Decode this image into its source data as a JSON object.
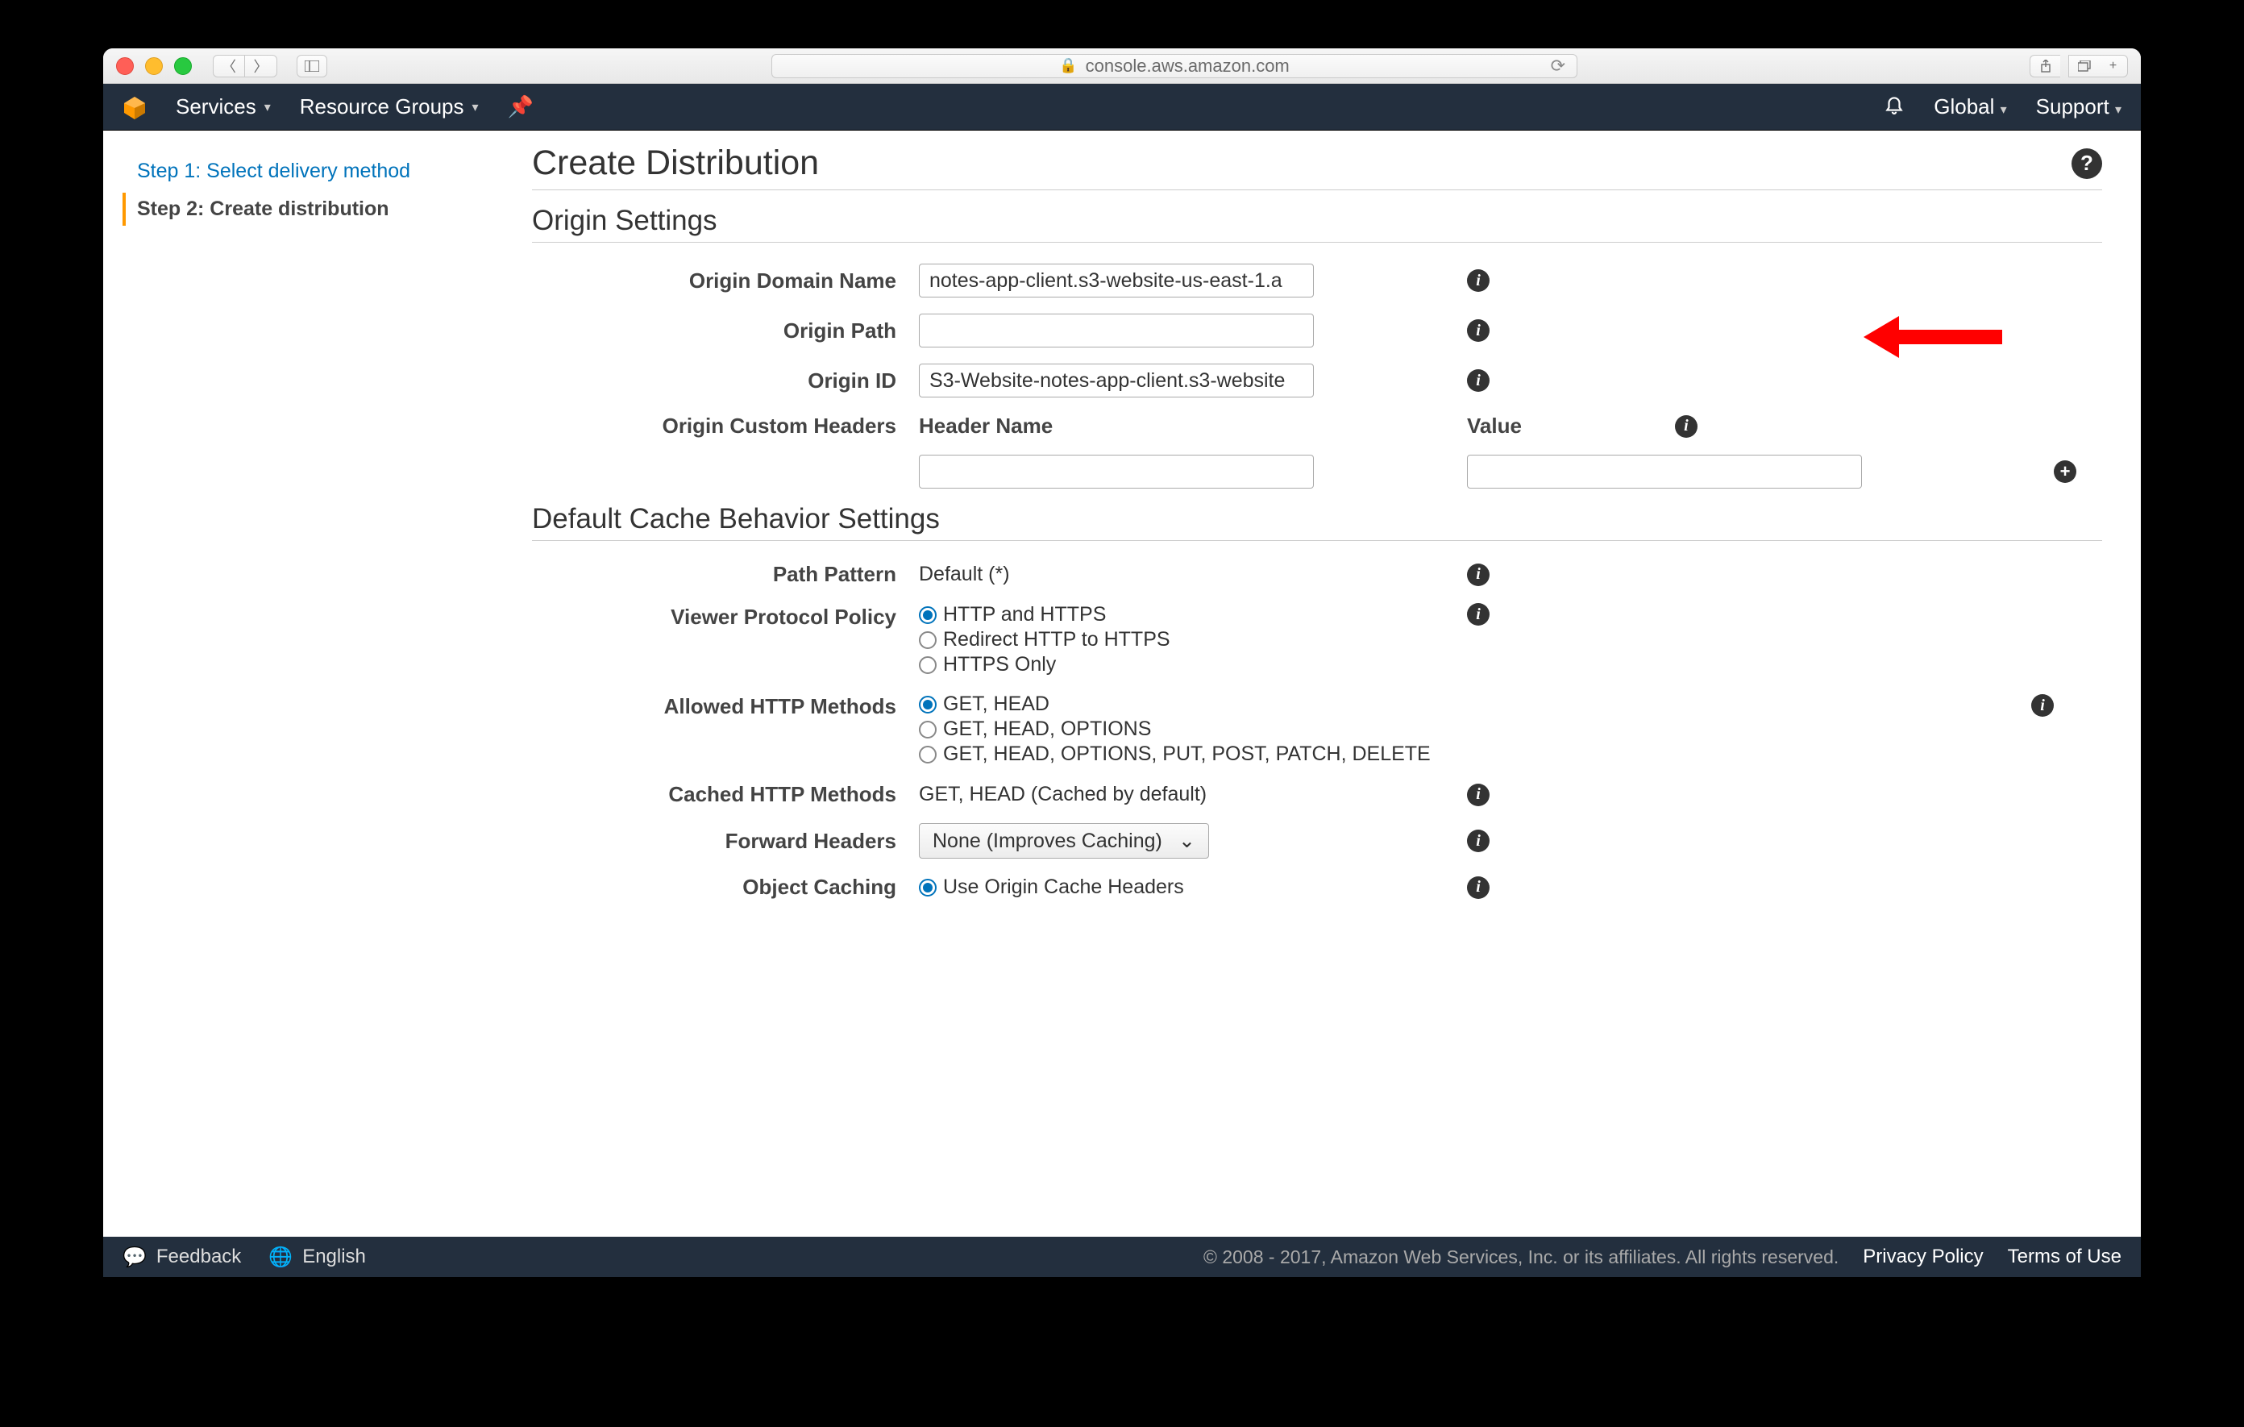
{
  "browser": {
    "url": "console.aws.amazon.com"
  },
  "awsbar": {
    "services": "Services",
    "resourceGroups": "Resource Groups",
    "global": "Global",
    "support": "Support"
  },
  "sidebar": {
    "step1": "Step 1: Select delivery method",
    "step2": "Step 2: Create distribution"
  },
  "page": {
    "title": "Create Distribution",
    "section_origin": "Origin Settings",
    "section_cache": "Default Cache Behavior Settings"
  },
  "origin": {
    "domainName": {
      "label": "Origin Domain Name",
      "value": "notes-app-client.s3-website-us-east-1.a"
    },
    "path": {
      "label": "Origin Path",
      "value": ""
    },
    "id": {
      "label": "Origin ID",
      "value": "S3-Website-notes-app-client.s3-website"
    },
    "customHeaders": {
      "label": "Origin Custom Headers",
      "headerName": "Header Name",
      "valueCol": "Value"
    }
  },
  "cache": {
    "pathPattern": {
      "label": "Path Pattern",
      "value": "Default (*)"
    },
    "viewerProtocol": {
      "label": "Viewer Protocol Policy",
      "options": [
        "HTTP and HTTPS",
        "Redirect HTTP to HTTPS",
        "HTTPS Only"
      ],
      "selected": 0
    },
    "allowedMethods": {
      "label": "Allowed HTTP Methods",
      "options": [
        "GET, HEAD",
        "GET, HEAD, OPTIONS",
        "GET, HEAD, OPTIONS, PUT, POST, PATCH, DELETE"
      ],
      "selected": 0
    },
    "cachedMethods": {
      "label": "Cached HTTP Methods",
      "value": "GET, HEAD (Cached by default)"
    },
    "forwardHeaders": {
      "label": "Forward Headers",
      "value": "None (Improves Caching)"
    },
    "objectCaching": {
      "label": "Object Caching",
      "options": [
        "Use Origin Cache Headers"
      ],
      "selected": 0
    }
  },
  "footer": {
    "feedback": "Feedback",
    "language": "English",
    "copyright": "© 2008 - 2017, Amazon Web Services, Inc. or its affiliates. All rights reserved.",
    "privacy": "Privacy Policy",
    "terms": "Terms of Use"
  }
}
